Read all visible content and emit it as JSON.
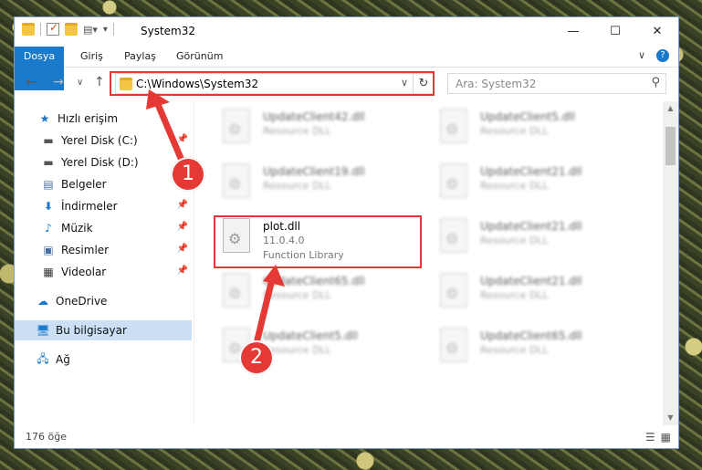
{
  "title": "System32",
  "ribbon": {
    "tabs": [
      "Dosya",
      "Giriş",
      "Paylaş",
      "Görünüm"
    ]
  },
  "address": {
    "path": "C:\\Windows\\System32",
    "search_placeholder": "Ara: System32"
  },
  "sidebar": {
    "items": [
      {
        "label": "Hızlı erişim",
        "icon": "star-icon"
      },
      {
        "label": "Yerel Disk (C:)",
        "icon": "drive-icon",
        "pinned": true
      },
      {
        "label": "Yerel Disk (D:)",
        "icon": "drive-icon"
      },
      {
        "label": "Belgeler",
        "icon": "documents-icon"
      },
      {
        "label": "İndirmeler",
        "icon": "download-icon",
        "pinned": true
      },
      {
        "label": "Müzik",
        "icon": "music-icon",
        "pinned": true
      },
      {
        "label": "Resimler",
        "icon": "pictures-icon",
        "pinned": true
      },
      {
        "label": "Videolar",
        "icon": "videos-icon",
        "pinned": true
      },
      {
        "label": "OneDrive",
        "icon": "cloud-icon"
      },
      {
        "label": "Bu bilgisayar",
        "icon": "computer-icon",
        "selected": true
      },
      {
        "label": "Ağ",
        "icon": "network-icon"
      }
    ]
  },
  "files": {
    "highlighted": {
      "name": "plot.dll",
      "version": "11.0.4.0",
      "type": "Function Library"
    },
    "left": [
      {
        "name": "UpdateClient42.dll",
        "type": "Resource DLL"
      },
      {
        "name": "UpdateClient19.dll",
        "type": "Resource DLL"
      },
      {
        "name": "UpdateClient65.dll",
        "type": "Resource DLL"
      },
      {
        "name": "UpdateClient5.dll",
        "type": "Resource DLL"
      }
    ],
    "right": [
      {
        "name": "UpdateClient5.dll",
        "type": "Resource DLL"
      },
      {
        "name": "UpdateClient21.dll",
        "type": "Resource DLL"
      },
      {
        "name": "UpdateClient21.dll",
        "type": "Resource DLL"
      },
      {
        "name": "UpdateClient21.dll",
        "type": "Resource DLL"
      },
      {
        "name": "UpdateClient65.dll",
        "type": "Resource DLL"
      }
    ]
  },
  "status": {
    "count": "176 öğe"
  },
  "annotations": [
    "1",
    "2"
  ],
  "colors": {
    "accent": "#1979ca",
    "highlight": "#e53935",
    "selected": "#cce0f5"
  }
}
